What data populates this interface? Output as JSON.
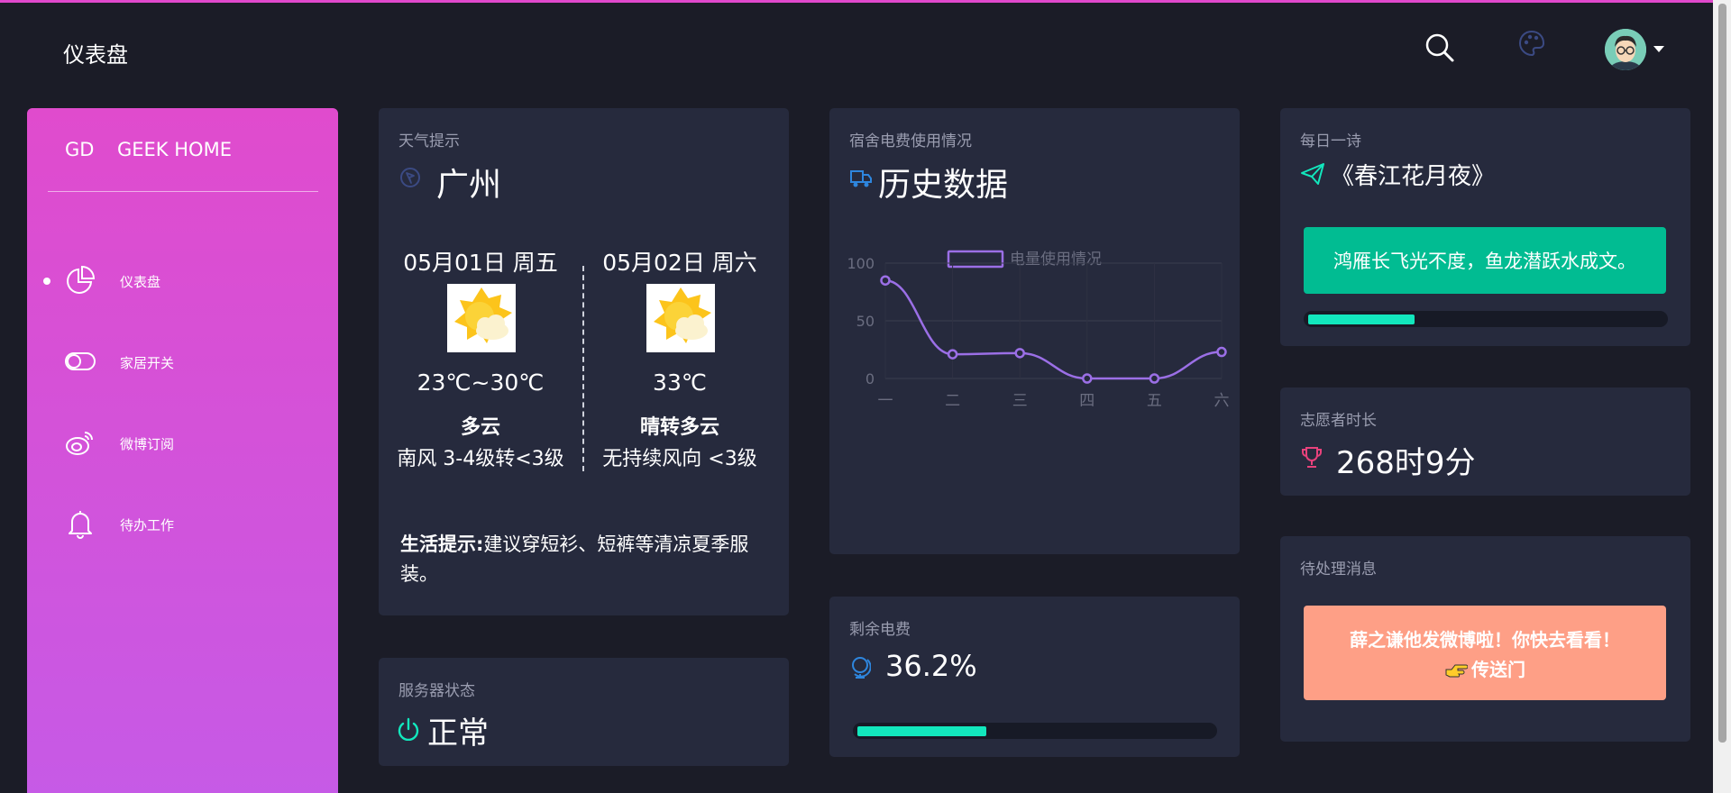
{
  "header": {
    "title": "仪表盘"
  },
  "sidebar": {
    "brand_short": "GD",
    "brand_name": "GEEK HOME",
    "items": [
      {
        "label": "仪表盘",
        "icon": "pie-chart-icon",
        "active": true
      },
      {
        "label": "家居开关",
        "icon": "toggle-icon",
        "active": false
      },
      {
        "label": "微博订阅",
        "icon": "weibo-icon",
        "active": false
      },
      {
        "label": "待办工作",
        "icon": "bell-icon",
        "active": false
      }
    ]
  },
  "weather": {
    "title": "天气提示",
    "city": "广州",
    "days": [
      {
        "date": "05月01日 周五",
        "temp": "23℃~30℃",
        "condition": "多云",
        "wind": "南风 3-4级转<3级"
      },
      {
        "date": "05月02日 周六",
        "temp": "33℃",
        "condition": "晴转多云",
        "wind": "无持续风向 <3级"
      }
    ],
    "tip_label": "生活提示:",
    "tip_text": "建议穿短衫、短裤等清凉夏季服装。"
  },
  "server": {
    "title": "服务器状态",
    "status": "正常"
  },
  "electricity": {
    "title": "宿舍电费使用情况",
    "heading": "历史数据"
  },
  "chart_data": {
    "type": "line",
    "legend": [
      "电量使用情况"
    ],
    "categories": [
      "一",
      "二",
      "三",
      "四",
      "五",
      "六"
    ],
    "series": [
      {
        "name": "电量使用情况",
        "values": [
          85,
          21,
          22,
          0,
          0,
          23
        ]
      }
    ],
    "yticks": [
      0,
      50,
      100
    ],
    "ylim": [
      0,
      100
    ],
    "color": "#9b6fe6"
  },
  "balance": {
    "title": "剩余电费",
    "value": "36.2%",
    "percent": 0.362
  },
  "poem": {
    "title": "每日一诗",
    "name": "《春江花月夜》",
    "line": "鸿雁长飞光不度，鱼龙潜跃水成文。",
    "progress": 0.3
  },
  "volunteer": {
    "title": "志愿者时长",
    "value": "268时9分"
  },
  "messages": {
    "title": "待处理消息",
    "text": "薛之谦他发微博啦！你快去看看！",
    "link": "传送门"
  },
  "colors": {
    "accent_pink": "#e048cc",
    "card_bg": "#262a3d",
    "teal": "#01bc92",
    "progress": "#12e7bd",
    "salmon": "#fe9f86"
  }
}
